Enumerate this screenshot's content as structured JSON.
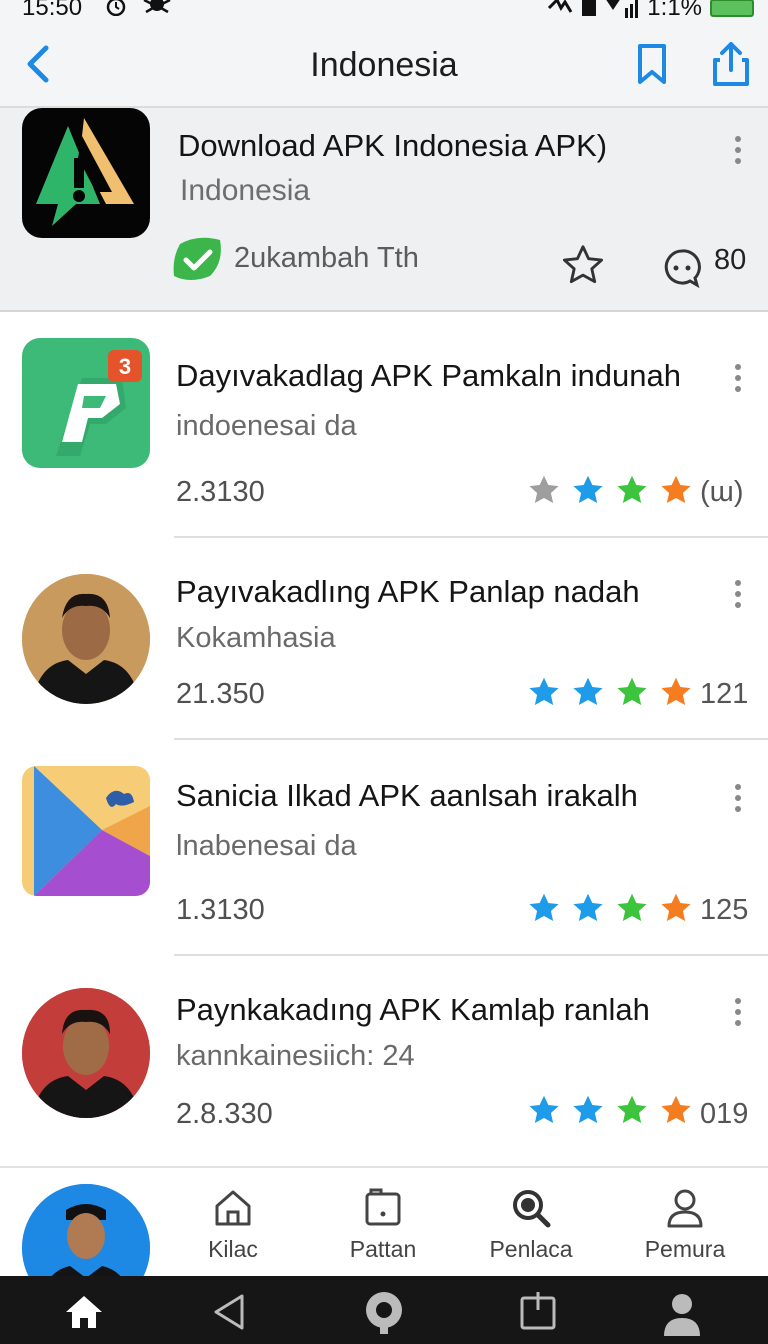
{
  "status": {
    "time": "15:50",
    "battery": "1:1%"
  },
  "app_bar": {
    "title": "Indonesia"
  },
  "featured": {
    "title": "Download APK Indonesia APK)",
    "subtitle": "Indonesia",
    "meta": "2ukambah Tth",
    "comment_count": "80"
  },
  "items": [
    {
      "title": "Dayıvakadlag APK Pamkaln indunah",
      "subtitle": "indoenesai da",
      "version": "2.3130",
      "rating": "(ɯ)",
      "badge": "3"
    },
    {
      "title": "Payıvakadlıng APK Panlap nadah",
      "subtitle": "Kokamhasia",
      "version": "21.350",
      "rating": "121"
    },
    {
      "title": "Sanicia Ilkad APK aanlsah irakalh",
      "subtitle": "lnabenesai da",
      "version": "1.3130",
      "rating": "125"
    },
    {
      "title": "Paynkakadıng APK Kamlaþ ranlah",
      "subtitle": "kannkainesiich: 24",
      "version": "2.8.330",
      "rating": "019"
    }
  ],
  "bottom_nav": [
    {
      "label": "Kilac",
      "icon": "home-outline-icon"
    },
    {
      "label": "Pattan",
      "icon": "folder-icon"
    },
    {
      "label": "Penlaca",
      "icon": "search-icon"
    },
    {
      "label": "Pemura",
      "icon": "profile-icon"
    }
  ],
  "colors": {
    "accent": "#1e88e5",
    "star_blue": "#1e9be9",
    "star_green": "#3cc43c",
    "star_orange": "#f57c1f",
    "star_gray": "#9e9e9e"
  }
}
